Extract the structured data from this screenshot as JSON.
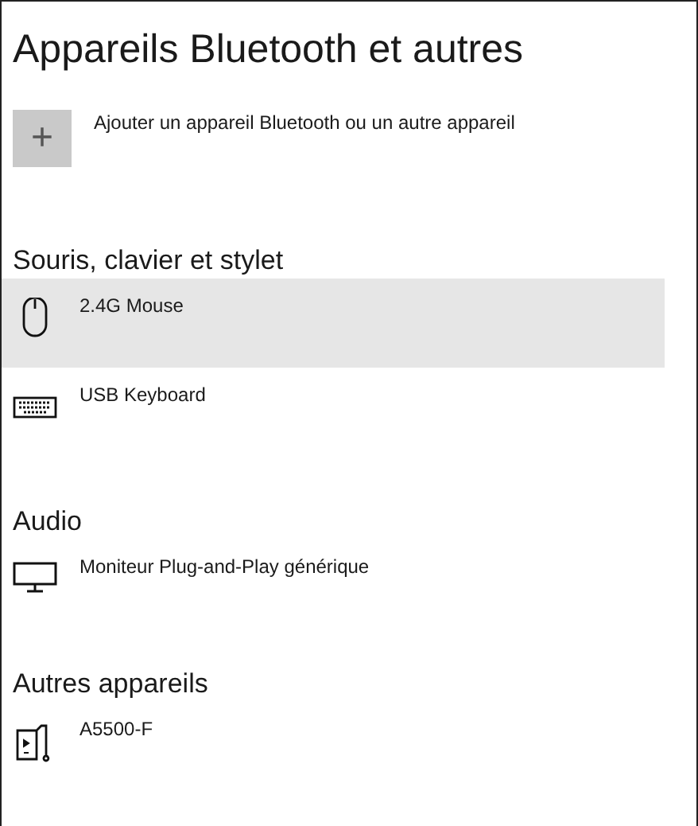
{
  "title": "Appareils Bluetooth et autres",
  "add_button": {
    "icon": "+",
    "label": "Ajouter un appareil Bluetooth ou un autre appareil"
  },
  "sections": [
    {
      "heading": "Souris, clavier et stylet",
      "devices": [
        {
          "name": "2.4G Mouse",
          "kind": "mouse",
          "selected": true
        },
        {
          "name": "USB Keyboard",
          "kind": "keyboard",
          "selected": false
        }
      ]
    },
    {
      "heading": "Audio",
      "devices": [
        {
          "name": "Moniteur Plug-and-Play générique",
          "kind": "monitor",
          "selected": false
        }
      ]
    },
    {
      "heading": "Autres appareils",
      "devices": [
        {
          "name": "A5500-F",
          "kind": "media",
          "selected": false
        }
      ]
    }
  ]
}
